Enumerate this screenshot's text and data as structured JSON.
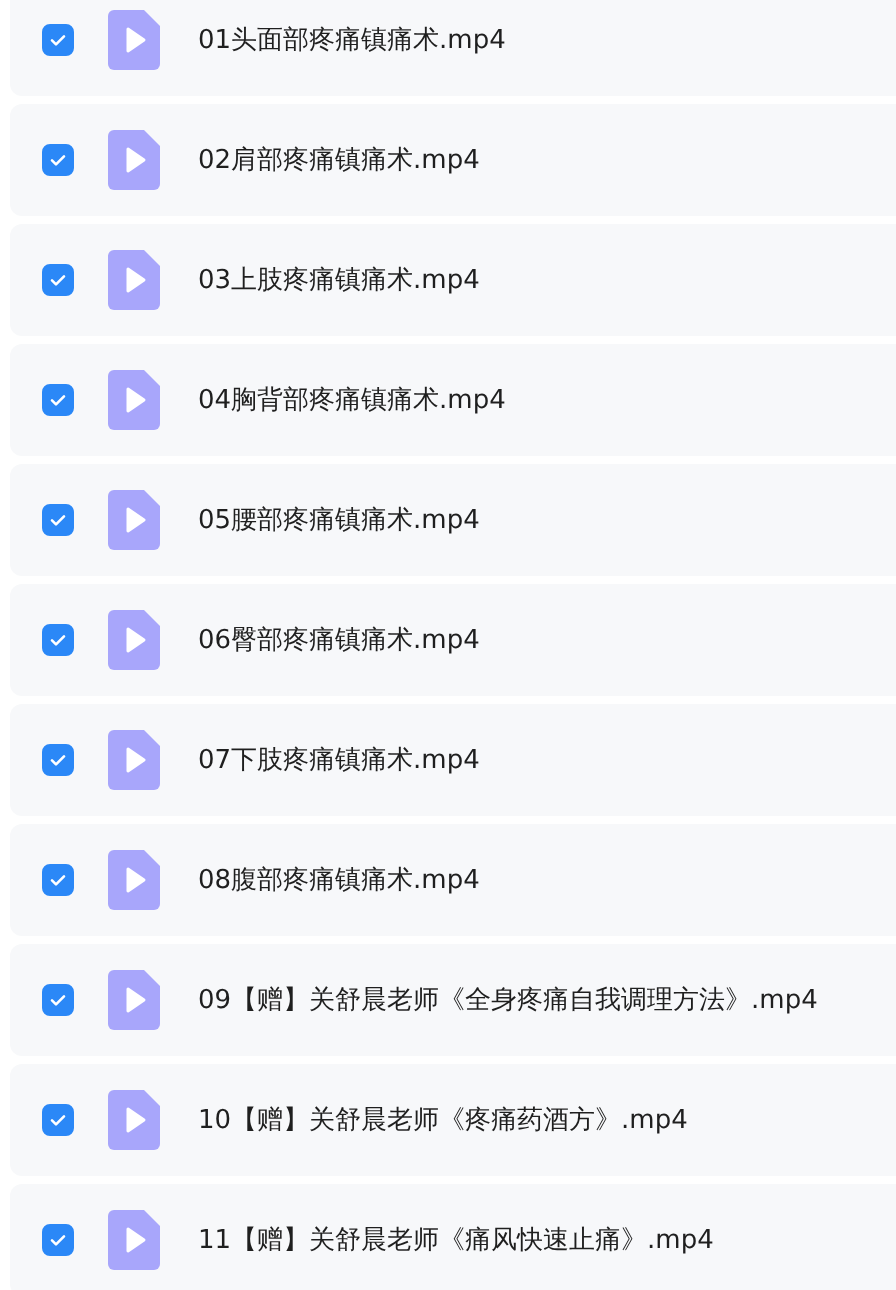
{
  "files": [
    {
      "name": "01头面部疼痛镇痛术.mp4",
      "checked": true
    },
    {
      "name": "02肩部疼痛镇痛术.mp4",
      "checked": true
    },
    {
      "name": "03上肢疼痛镇痛术.mp4",
      "checked": true
    },
    {
      "name": "04胸背部疼痛镇痛术.mp4",
      "checked": true
    },
    {
      "name": "05腰部疼痛镇痛术.mp4",
      "checked": true
    },
    {
      "name": "06臀部疼痛镇痛术.mp4",
      "checked": true
    },
    {
      "name": "07下肢疼痛镇痛术.mp4",
      "checked": true
    },
    {
      "name": "08腹部疼痛镇痛术.mp4",
      "checked": true
    },
    {
      "name": "09【赠】关舒晨老师《全身疼痛自我调理方法》.mp4",
      "checked": true
    },
    {
      "name": "10【赠】关舒晨老师《疼痛药酒方》.mp4",
      "checked": true
    },
    {
      "name": "11【赠】关舒晨老师《痛风快速止痛》.mp4",
      "checked": true
    }
  ]
}
